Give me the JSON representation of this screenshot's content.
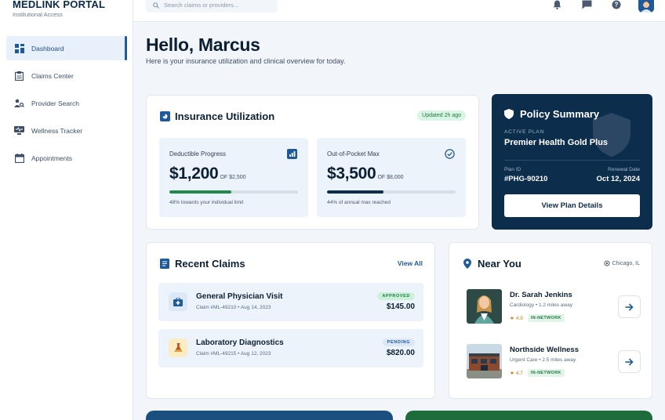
{
  "brand": {
    "title": "MEDLINK PORTAL",
    "subtitle": "Institutional Access"
  },
  "search": {
    "placeholder": "Search claims or providers..."
  },
  "sidebar": {
    "items": [
      {
        "label": "Dashboard",
        "icon": "dashboard-icon",
        "active": true
      },
      {
        "label": "Claims Center",
        "icon": "clipboard-icon",
        "active": false
      },
      {
        "label": "Provider Search",
        "icon": "people-search-icon",
        "active": false
      },
      {
        "label": "Wellness Tracker",
        "icon": "monitor-icon",
        "active": false
      },
      {
        "label": "Appointments",
        "icon": "calendar-icon",
        "active": false
      }
    ]
  },
  "header": {
    "greeting": "Hello, Marcus",
    "subtitle": "Here is your insurance utilization and clinical overview for today."
  },
  "utilization": {
    "title": "Insurance Utilization",
    "updated": "Updated 2h ago",
    "deductible": {
      "label": "Deductible Progress",
      "value": "$1,200",
      "of": "OF $2,500",
      "progress": 0.48,
      "note": "48% towards your individual limit",
      "color": "#1f8a4c"
    },
    "oop": {
      "label": "Out-of-Pocket Max",
      "value": "$3,500",
      "of": "OF $8,000",
      "progress": 0.44,
      "note": "44% of annual max reached",
      "color": "#0d2d4d"
    }
  },
  "policy": {
    "title": "Policy Summary",
    "active_label": "ACTIVE PLAN",
    "plan": "Premier Health Gold Plus",
    "id_label": "Plan ID",
    "id": "#PHG-90210",
    "renewal_label": "Renewal Date",
    "renewal": "Oct 12, 2024",
    "button": "View Plan Details"
  },
  "claims": {
    "title": "Recent Claims",
    "view_all": "View All",
    "items": [
      {
        "title": "General Physician Visit",
        "sub": "Claim #ML-49210 • Aug 14, 2023",
        "status": "APPROVED",
        "amount": "$145.00",
        "icon": "medical-kit-icon"
      },
      {
        "title": "Laboratory Diagnostics",
        "sub": "Claim #ML-49215 • Aug 12, 2023",
        "status": "PENDING",
        "amount": "$820.00",
        "icon": "flask-icon"
      }
    ]
  },
  "near": {
    "title": "Near You",
    "location": "Chicago, IL",
    "items": [
      {
        "name": "Dr. Sarah Jenkins",
        "sub": "Cardiology • 1.2 miles away",
        "rating": "4.9",
        "network": "IN-NETWORK"
      },
      {
        "name": "Northside Wellness",
        "sub": "Urgent Care • 2.5 miles away",
        "rating": "4.7",
        "network": "IN-NETWORK"
      }
    ]
  },
  "colors": {
    "primary": "#0d2d4d",
    "accent": "#1e5a99",
    "success": "#1f8a4c",
    "banner_left": "#1a4f80",
    "banner_right": "#1e6b3c"
  }
}
